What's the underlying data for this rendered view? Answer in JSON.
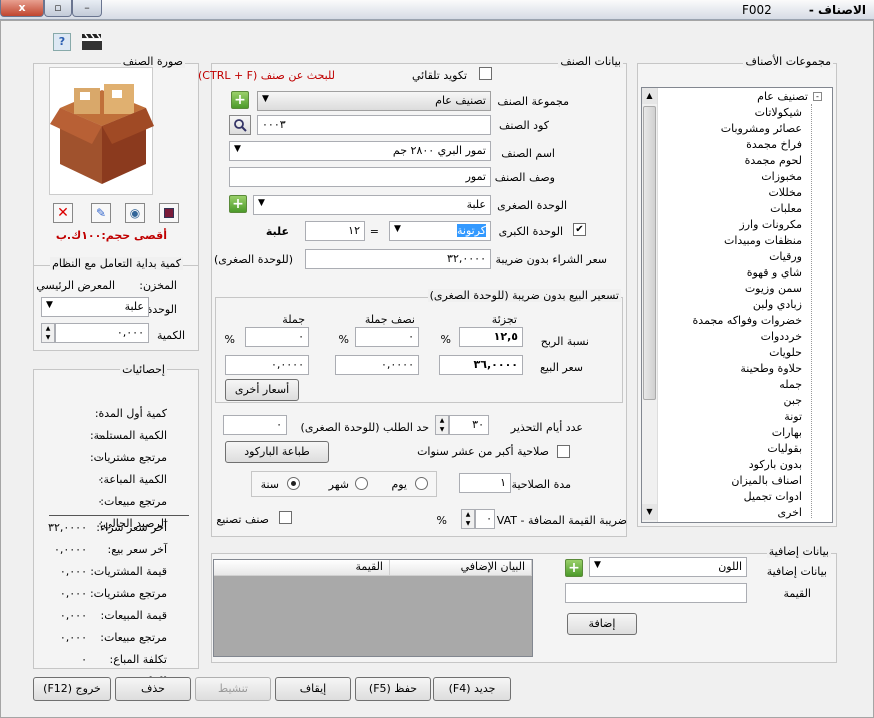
{
  "window": {
    "title": "الاصناف - F002",
    "title_main": "الاصناف -",
    "code": "F002",
    "close": "x",
    "max": "▫",
    "min": "–"
  },
  "toolbar": {
    "help_icon": "help-icon",
    "clapper_icon": "clapperboard-icon",
    "help_glyph": "?"
  },
  "item_data": {
    "group_title": "بيانات الصنف",
    "auto_code_label": "تكويد تلقائي",
    "search_hint": "للبحث عن صنف (CTRL + F)",
    "group_label": "مجموعة الصنف",
    "group_value": "تصنيف عام",
    "code_label": "كود الصنف",
    "code_value": "٠٠٠٣",
    "name_label": "اسم الصنف",
    "name_value": "تمور البري ٢٨٠٠ جم",
    "desc_label": "وصف الصنف",
    "desc_value": "تمور",
    "small_unit_label": "الوحدة الصغرى",
    "small_unit_value": "علبة",
    "big_unit_label": "الوحدة الكبرى",
    "big_unit_value": "كرتونة",
    "big_unit_checked": true,
    "equals": "=",
    "factor_value": "١٢",
    "factor_unit": "علبة",
    "purchase_label": "سعر الشراء بدون ضريبة",
    "purchase_value": "٣٢,٠٠٠٠",
    "purchase_unit": "(للوحدة الصغرى)"
  },
  "pricing": {
    "group_title": "تسعير البيع بدون ضريبة (للوحدة الصغرى)",
    "col_retail": "تجزئة",
    "col_half": "نصف جملة",
    "col_wholesale": "جملة",
    "margin_label": "نسبة الربح",
    "margin_retail": "١٢,٥",
    "margin_half": "٠",
    "margin_wholesale": "٠",
    "pct": "%",
    "price_label": "سعر البيع",
    "price_retail": "٣٦,٠٠٠٠",
    "price_half": "٠,٠٠٠٠",
    "price_wholesale": "٠,٠٠٠٠",
    "other_prices_button": "أسعار أخرى"
  },
  "alerts": {
    "warn_days_label": "عدد أيام التحذير",
    "warn_days_value": "٣٠",
    "reorder_label": "حد الطلب (للوحدة الصغرى)",
    "reorder_value": "٠",
    "expiry10_label": "صلاحية أكبر من عشر سنوات",
    "barcode_button": "طباعة الباركود",
    "expiry_label": "مدة الصلاحية",
    "expiry_value": "١",
    "opt_day": "يوم",
    "opt_month": "شهر",
    "opt_year": "سنة",
    "vat_label": "ضريبة القيمة المضافة - VAT",
    "vat_value": "٠",
    "vat_pct": "%",
    "manufactured_label": "صنف تصنيع"
  },
  "image": {
    "title": "صورة الصنف",
    "max_size": "أقصى حجم:١٠٠ك.ب",
    "icons": [
      "delete-image-icon",
      "edit-image-icon",
      "camera-icon",
      "save-image-icon"
    ]
  },
  "opening": {
    "title": "كمية بداية التعامل مع النظام",
    "store_label": "المخزن:",
    "store_value": "المعرض الرئيسي",
    "unit_label": "الوحدة",
    "unit_value": "علبة",
    "qty_label": "الكمية",
    "qty_value": "٠,٠٠٠"
  },
  "stats": {
    "title": "إحصائيات",
    "rows": [
      {
        "label": "كمية أول المدة:",
        "value": "٠"
      },
      {
        "label": "الكمية المستلمة:",
        "value": "٠"
      },
      {
        "label": "مرتجع مشتريات:",
        "value": "٠"
      },
      {
        "label": "الكمية المباعة:",
        "value": "٠"
      },
      {
        "label": "مرتجع مبيعات:",
        "value": "٠"
      },
      {
        "label": "الرصيد الحالي:",
        "value": "٠"
      }
    ],
    "rows2": [
      {
        "label": "آخر سعر شراء:",
        "value": "٣٢,٠٠٠٠"
      },
      {
        "label": "آخر سعر بيع:",
        "value": "٠,٠٠٠٠"
      },
      {
        "label": "قيمة المشتريات:",
        "value": "٠,٠٠٠"
      },
      {
        "label": "مرتجع مشتريات:",
        "value": "٠,٠٠٠"
      },
      {
        "label": "قيمة المبيعات:",
        "value": "٠,٠٠٠"
      },
      {
        "label": "مرتجع مبيعات:",
        "value": "٠,٠٠٠"
      },
      {
        "label": "تكلفة المباع:",
        "value": "٠"
      },
      {
        "label": "العائد:",
        "value": "٠,٠٠٠"
      }
    ]
  },
  "groups_tree": {
    "title": "مجموعات الأصناف",
    "root": "تصنيف عام",
    "items": [
      "شيكولاتات",
      "عصائر ومشروبات",
      "فراخ مجمدة",
      "لحوم مجمدة",
      "مخبوزات",
      "مخللات",
      "معلبات",
      "مكرونات وارز",
      "منظفات ومبيدات",
      "ورقيات",
      "شاي و قهوة",
      "سمن وزيوت",
      "زبادي ولبن",
      "خضروات وفواكه مجمدة",
      "خرددوات",
      "حلويات",
      "حلاوة وطحينة",
      "جمله",
      "جبن",
      "تونة",
      "بهارات",
      "بقوليات",
      "بدون باركود",
      "اصناف بالميزان",
      "ادوات تجميل",
      "اخرى"
    ]
  },
  "extra": {
    "title": "بيانات إضافية",
    "label": "بيانات إضافية",
    "combo_value": "اللون",
    "value_label": "القيمة",
    "add_button": "إضافة",
    "col_extra": "البيان الإضافي",
    "col_value": "القيمة"
  },
  "footer": {
    "new": "جديد (F4)",
    "save": "حفظ (F5)",
    "stop": "إيقاف",
    "activate": "تنشيط",
    "delete": "حذف",
    "exit": "خروج (F12)"
  }
}
